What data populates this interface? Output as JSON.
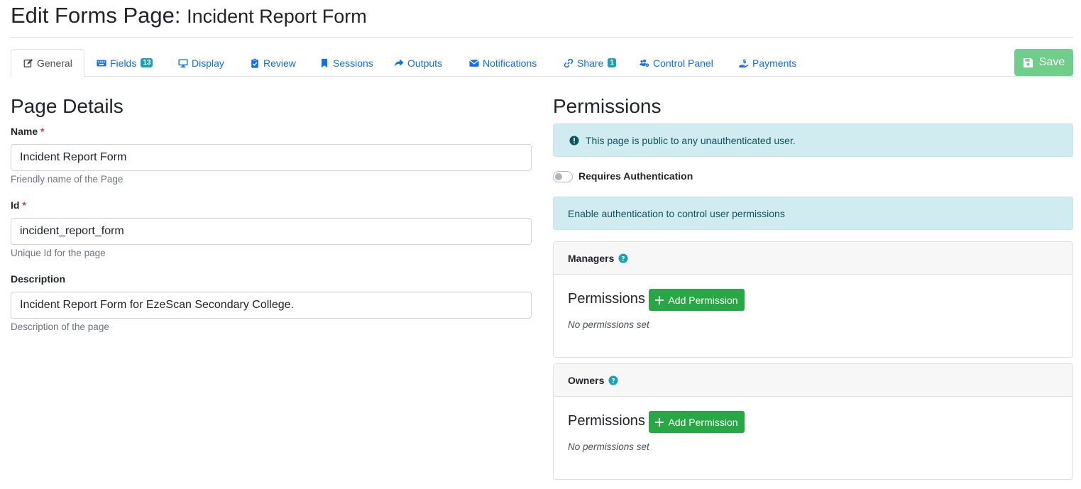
{
  "header": {
    "title_prefix": "Edit Forms Page:",
    "title_name": "Incident Report Form"
  },
  "tabs": [
    {
      "label": "General",
      "icon": "edit-icon",
      "active": true
    },
    {
      "label": "Fields",
      "icon": "keyboard-icon",
      "badge": "13"
    },
    {
      "label": "Display",
      "icon": "monitor-icon"
    },
    {
      "label": "Review",
      "icon": "clipboard-check-icon"
    },
    {
      "label": "Sessions",
      "icon": "bookmark-icon"
    },
    {
      "label": "Outputs",
      "icon": "share-arrow-icon"
    },
    {
      "label": "Notifications",
      "icon": "envelope-icon"
    },
    {
      "label": "Share",
      "icon": "link-icon",
      "badge": "1"
    },
    {
      "label": "Control Panel",
      "icon": "users-cog-icon"
    },
    {
      "label": "Payments",
      "icon": "hand-dollar-icon"
    }
  ],
  "toolbar": {
    "save_label": "Save"
  },
  "details": {
    "title": "Page Details",
    "name": {
      "label": "Name",
      "required_mark": "*",
      "value": "Incident Report Form",
      "help": "Friendly name of the Page"
    },
    "id": {
      "label": "Id",
      "required_mark": "*",
      "value": "incident_report_form",
      "help": "Unique Id for the page"
    },
    "description": {
      "label": "Description",
      "value": "Incident Report Form for EzeScan Secondary College.",
      "help": "Description of the page"
    }
  },
  "permissions": {
    "title": "Permissions",
    "public_notice": "This page is public to any unauthenticated user.",
    "requires_auth_label": "Requires Authentication",
    "requires_auth_enabled": false,
    "auth_notice": "Enable authentication to control user permissions",
    "managers": {
      "header": "Managers",
      "title": "Permissions",
      "add_label": "Add Permission",
      "empty": "No permissions set"
    },
    "owners": {
      "header": "Owners",
      "title": "Permissions",
      "add_label": "Add Permission",
      "empty": "No permissions set"
    }
  },
  "colors": {
    "link": "#0d6efd",
    "success": "#28a745",
    "save_disabled": "#6fcf8a",
    "info_bg": "#d1ecf1",
    "info_text": "#0c5460",
    "badge": "#17a2b8",
    "required": "#dc3545"
  }
}
